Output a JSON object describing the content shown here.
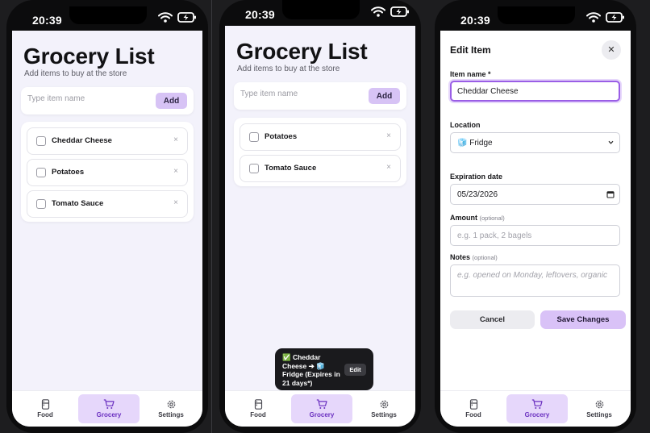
{
  "status": {
    "time": "20:39"
  },
  "screen1": {
    "title": "Grocery List",
    "subtitle": "Add items to buy at the store",
    "input_placeholder": "Type item name",
    "add_label": "Add",
    "items": [
      {
        "label": "Cheddar Cheese",
        "remove": "×"
      },
      {
        "label": "Potatoes",
        "remove": "×"
      },
      {
        "label": "Tomato Sauce",
        "remove": "×"
      }
    ]
  },
  "screen2": {
    "title": "Grocery List",
    "subtitle": "Add items to buy at the store",
    "input_placeholder": "Type item name",
    "add_label": "Add",
    "items": [
      {
        "label": "Potatoes",
        "remove": "×"
      },
      {
        "label": "Tomato Sauce",
        "remove": "×"
      }
    ],
    "toast": {
      "text": "✅ Cheddar Cheese ➔ 🧊 Fridge (Expires in 21 days*)",
      "button": "Edit"
    }
  },
  "screen3": {
    "modal_title": "Edit Item",
    "close": "✕",
    "name_label": "Item name *",
    "name_value": "Cheddar Cheese",
    "location_label": "Location",
    "location_value": "🧊 Fridge",
    "expiration_label": "Expiration date",
    "expiration_value": "05/23/2026",
    "amount_label": "Amount",
    "amount_optional": "(optional)",
    "amount_placeholder": "e.g. 1 pack, 2 bagels",
    "notes_label": "Notes",
    "notes_optional": "(optional)",
    "notes_placeholder": "e.g. opened on Monday, leftovers, organic",
    "cancel_label": "Cancel",
    "save_label": "Save Changes"
  },
  "tabs": [
    {
      "label": "Food",
      "icon": "fridge-icon"
    },
    {
      "label": "Grocery",
      "icon": "cart-icon",
      "active": true
    },
    {
      "label": "Settings",
      "icon": "gear-icon"
    }
  ],
  "colors": {
    "accent": "#d7c3f5",
    "active_tab_bg": "#e6d7fb",
    "active_tab_text": "#6a2fc0",
    "focus_border": "#9a5ee6"
  }
}
